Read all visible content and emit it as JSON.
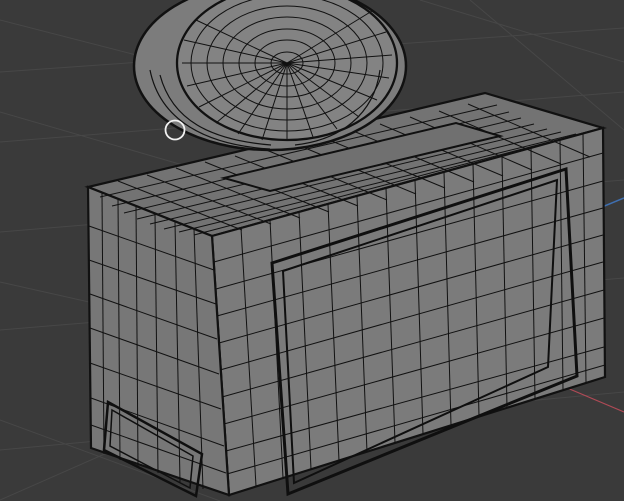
{
  "viewport": {
    "title": "",
    "mode": "",
    "background_color": "#3a3a3a",
    "grid_color": "#474747",
    "axis_colors": {
      "x": "#b04a56",
      "y": "#4f9a4f",
      "z": "#3f6fb0"
    },
    "mesh_face_color": "#7a7a7a",
    "mesh_edge_color": "#141414",
    "icons": {
      "cursor": "3d-cursor-icon"
    }
  }
}
